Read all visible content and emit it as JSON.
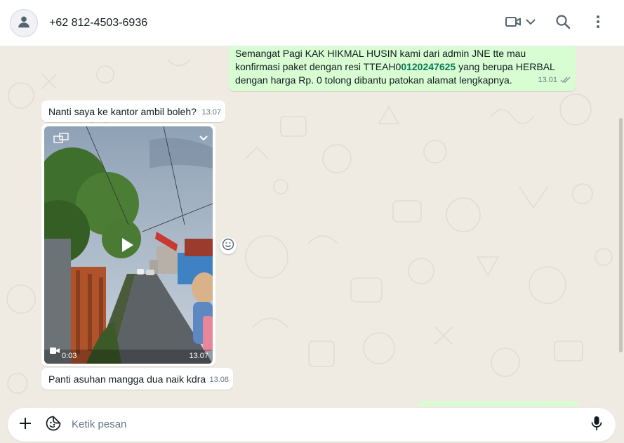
{
  "header": {
    "contact_name": "+62 812-4503-6936",
    "icons": [
      "person-avatar-icon",
      "video-call-icon",
      "chevron-down-icon",
      "search-icon",
      "more-vertical-icon"
    ]
  },
  "messages": [
    {
      "direction": "outgoing",
      "text_before": "Semangat Pagi KAK HIKMAL HUSIN kami dari admin JNE tte mau konfirmasi paket dengan resi TTEAH0",
      "text_link": "0120247625",
      "text_after": " yang berupa HERBAL dengan harga Rp. 0 tolong dibantu patokan alamat lengkapnya.",
      "time": "13.01",
      "status": "read"
    },
    {
      "direction": "incoming",
      "text": "Nanti saya ke kantor ambil boleh?",
      "time": "13.07"
    },
    {
      "direction": "incoming",
      "type": "video",
      "duration": "0:03",
      "time": "13.07"
    },
    {
      "direction": "incoming",
      "text": "Panti asuhan mangga dua naik kdra",
      "time": "13.08"
    }
  ],
  "composer": {
    "placeholder": "Ketik pesan",
    "icons": [
      "plus-icon",
      "sticker-icon",
      "microphone-icon"
    ]
  },
  "colors": {
    "outgoing_bubble": "#d9fdd3",
    "incoming_bubble": "#ffffff",
    "chat_background": "#efeae2",
    "link_green": "#067a55",
    "read_tick": "#8696a0"
  }
}
